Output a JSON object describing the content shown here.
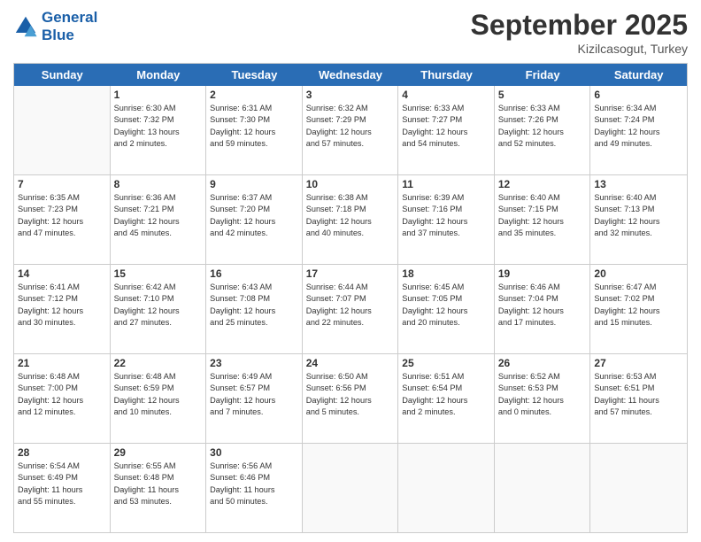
{
  "header": {
    "logo_line1": "General",
    "logo_line2": "Blue",
    "month": "September 2025",
    "location": "Kizilcasogut, Turkey"
  },
  "weekdays": [
    "Sunday",
    "Monday",
    "Tuesday",
    "Wednesday",
    "Thursday",
    "Friday",
    "Saturday"
  ],
  "rows": [
    [
      {
        "day": "",
        "lines": []
      },
      {
        "day": "1",
        "lines": [
          "Sunrise: 6:30 AM",
          "Sunset: 7:32 PM",
          "Daylight: 13 hours",
          "and 2 minutes."
        ]
      },
      {
        "day": "2",
        "lines": [
          "Sunrise: 6:31 AM",
          "Sunset: 7:30 PM",
          "Daylight: 12 hours",
          "and 59 minutes."
        ]
      },
      {
        "day": "3",
        "lines": [
          "Sunrise: 6:32 AM",
          "Sunset: 7:29 PM",
          "Daylight: 12 hours",
          "and 57 minutes."
        ]
      },
      {
        "day": "4",
        "lines": [
          "Sunrise: 6:33 AM",
          "Sunset: 7:27 PM",
          "Daylight: 12 hours",
          "and 54 minutes."
        ]
      },
      {
        "day": "5",
        "lines": [
          "Sunrise: 6:33 AM",
          "Sunset: 7:26 PM",
          "Daylight: 12 hours",
          "and 52 minutes."
        ]
      },
      {
        "day": "6",
        "lines": [
          "Sunrise: 6:34 AM",
          "Sunset: 7:24 PM",
          "Daylight: 12 hours",
          "and 49 minutes."
        ]
      }
    ],
    [
      {
        "day": "7",
        "lines": [
          "Sunrise: 6:35 AM",
          "Sunset: 7:23 PM",
          "Daylight: 12 hours",
          "and 47 minutes."
        ]
      },
      {
        "day": "8",
        "lines": [
          "Sunrise: 6:36 AM",
          "Sunset: 7:21 PM",
          "Daylight: 12 hours",
          "and 45 minutes."
        ]
      },
      {
        "day": "9",
        "lines": [
          "Sunrise: 6:37 AM",
          "Sunset: 7:20 PM",
          "Daylight: 12 hours",
          "and 42 minutes."
        ]
      },
      {
        "day": "10",
        "lines": [
          "Sunrise: 6:38 AM",
          "Sunset: 7:18 PM",
          "Daylight: 12 hours",
          "and 40 minutes."
        ]
      },
      {
        "day": "11",
        "lines": [
          "Sunrise: 6:39 AM",
          "Sunset: 7:16 PM",
          "Daylight: 12 hours",
          "and 37 minutes."
        ]
      },
      {
        "day": "12",
        "lines": [
          "Sunrise: 6:40 AM",
          "Sunset: 7:15 PM",
          "Daylight: 12 hours",
          "and 35 minutes."
        ]
      },
      {
        "day": "13",
        "lines": [
          "Sunrise: 6:40 AM",
          "Sunset: 7:13 PM",
          "Daylight: 12 hours",
          "and 32 minutes."
        ]
      }
    ],
    [
      {
        "day": "14",
        "lines": [
          "Sunrise: 6:41 AM",
          "Sunset: 7:12 PM",
          "Daylight: 12 hours",
          "and 30 minutes."
        ]
      },
      {
        "day": "15",
        "lines": [
          "Sunrise: 6:42 AM",
          "Sunset: 7:10 PM",
          "Daylight: 12 hours",
          "and 27 minutes."
        ]
      },
      {
        "day": "16",
        "lines": [
          "Sunrise: 6:43 AM",
          "Sunset: 7:08 PM",
          "Daylight: 12 hours",
          "and 25 minutes."
        ]
      },
      {
        "day": "17",
        "lines": [
          "Sunrise: 6:44 AM",
          "Sunset: 7:07 PM",
          "Daylight: 12 hours",
          "and 22 minutes."
        ]
      },
      {
        "day": "18",
        "lines": [
          "Sunrise: 6:45 AM",
          "Sunset: 7:05 PM",
          "Daylight: 12 hours",
          "and 20 minutes."
        ]
      },
      {
        "day": "19",
        "lines": [
          "Sunrise: 6:46 AM",
          "Sunset: 7:04 PM",
          "Daylight: 12 hours",
          "and 17 minutes."
        ]
      },
      {
        "day": "20",
        "lines": [
          "Sunrise: 6:47 AM",
          "Sunset: 7:02 PM",
          "Daylight: 12 hours",
          "and 15 minutes."
        ]
      }
    ],
    [
      {
        "day": "21",
        "lines": [
          "Sunrise: 6:48 AM",
          "Sunset: 7:00 PM",
          "Daylight: 12 hours",
          "and 12 minutes."
        ]
      },
      {
        "day": "22",
        "lines": [
          "Sunrise: 6:48 AM",
          "Sunset: 6:59 PM",
          "Daylight: 12 hours",
          "and 10 minutes."
        ]
      },
      {
        "day": "23",
        "lines": [
          "Sunrise: 6:49 AM",
          "Sunset: 6:57 PM",
          "Daylight: 12 hours",
          "and 7 minutes."
        ]
      },
      {
        "day": "24",
        "lines": [
          "Sunrise: 6:50 AM",
          "Sunset: 6:56 PM",
          "Daylight: 12 hours",
          "and 5 minutes."
        ]
      },
      {
        "day": "25",
        "lines": [
          "Sunrise: 6:51 AM",
          "Sunset: 6:54 PM",
          "Daylight: 12 hours",
          "and 2 minutes."
        ]
      },
      {
        "day": "26",
        "lines": [
          "Sunrise: 6:52 AM",
          "Sunset: 6:53 PM",
          "Daylight: 12 hours",
          "and 0 minutes."
        ]
      },
      {
        "day": "27",
        "lines": [
          "Sunrise: 6:53 AM",
          "Sunset: 6:51 PM",
          "Daylight: 11 hours",
          "and 57 minutes."
        ]
      }
    ],
    [
      {
        "day": "28",
        "lines": [
          "Sunrise: 6:54 AM",
          "Sunset: 6:49 PM",
          "Daylight: 11 hours",
          "and 55 minutes."
        ]
      },
      {
        "day": "29",
        "lines": [
          "Sunrise: 6:55 AM",
          "Sunset: 6:48 PM",
          "Daylight: 11 hours",
          "and 53 minutes."
        ]
      },
      {
        "day": "30",
        "lines": [
          "Sunrise: 6:56 AM",
          "Sunset: 6:46 PM",
          "Daylight: 11 hours",
          "and 50 minutes."
        ]
      },
      {
        "day": "",
        "lines": []
      },
      {
        "day": "",
        "lines": []
      },
      {
        "day": "",
        "lines": []
      },
      {
        "day": "",
        "lines": []
      }
    ]
  ]
}
